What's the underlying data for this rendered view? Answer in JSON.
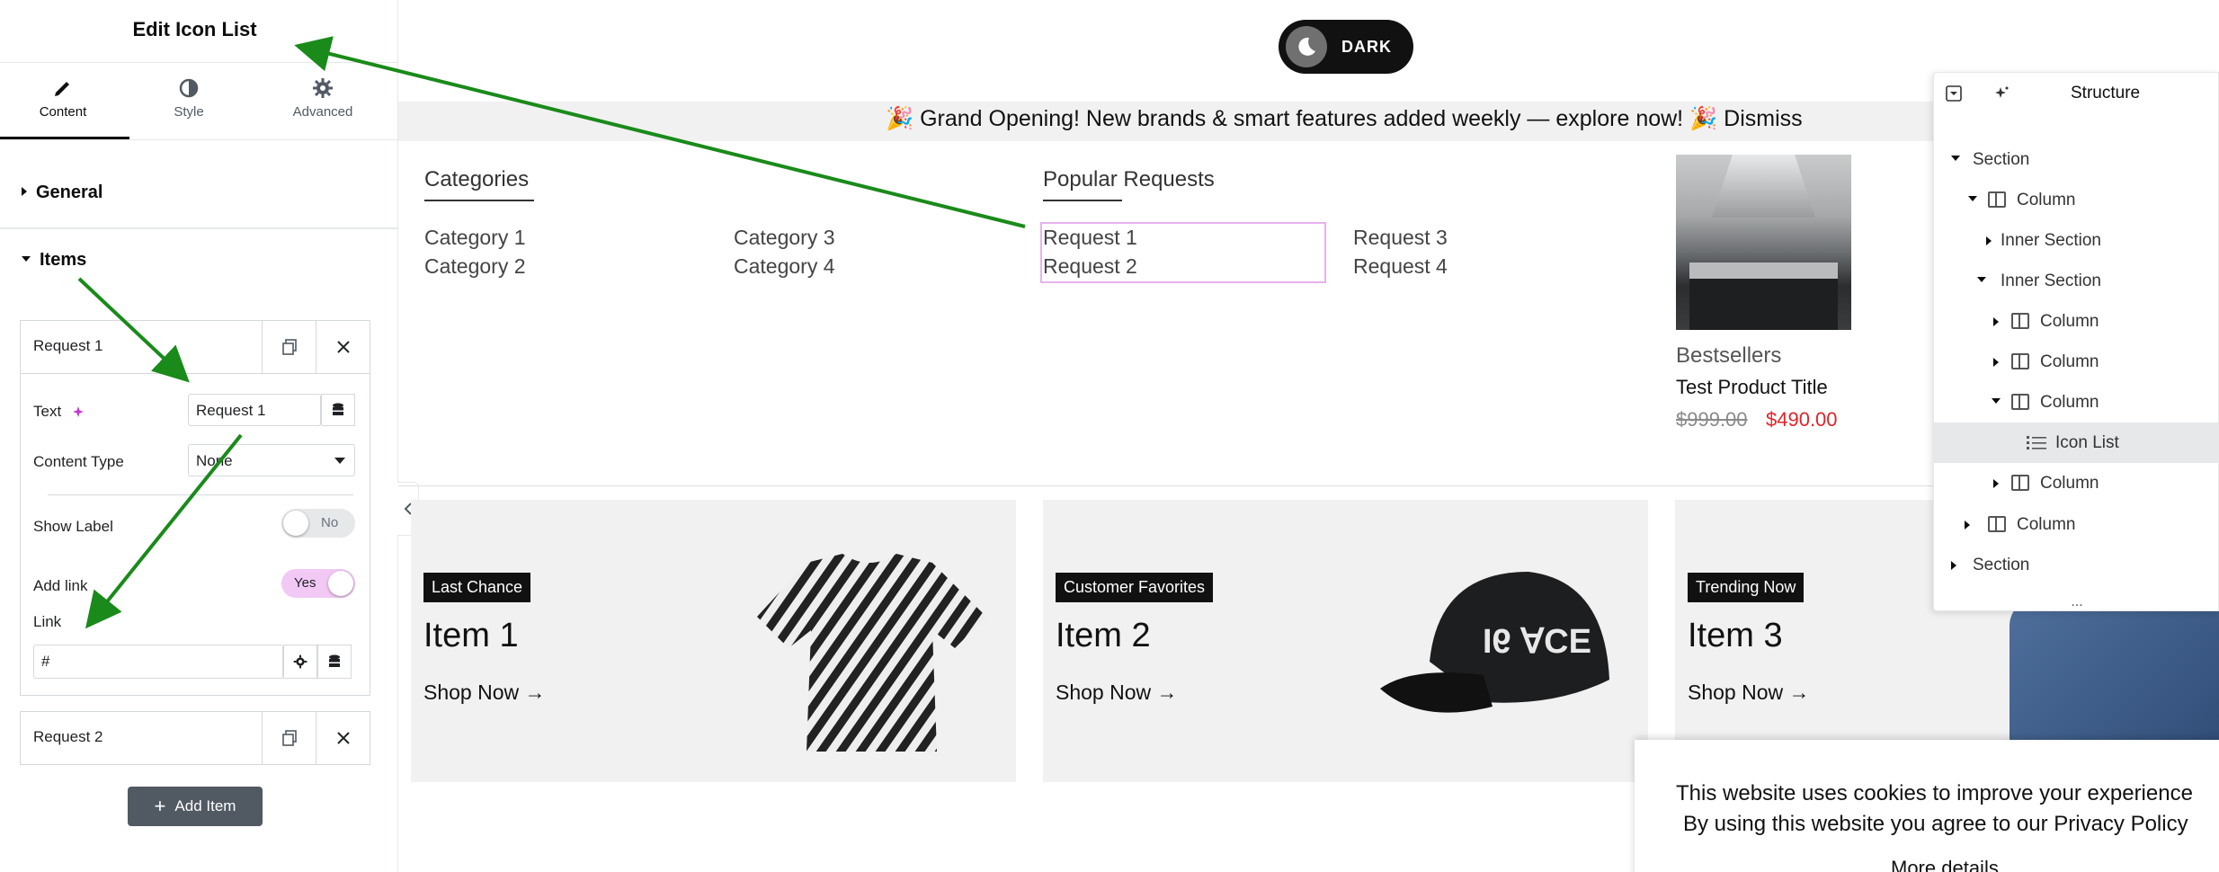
{
  "panel": {
    "title": "Edit Icon List",
    "tabs": [
      {
        "label": "Content",
        "icon": "pencil-icon"
      },
      {
        "label": "Style",
        "icon": "half-circle-icon"
      },
      {
        "label": "Advanced",
        "icon": "gear-icon"
      }
    ],
    "sections": {
      "general": "General",
      "items": "Items"
    },
    "items": [
      {
        "label": "Request 1",
        "fields": {
          "text_label": "Text",
          "text_value": "Request 1",
          "content_type_label": "Content Type",
          "content_type_value": "None",
          "show_label_label": "Show Label",
          "show_label_value": "No",
          "add_link_label": "Add link",
          "add_link_value": "Yes",
          "link_label": "Link",
          "link_value": "#"
        }
      },
      {
        "label": "Request 2"
      }
    ],
    "add_item_label": "Add Item"
  },
  "canvas": {
    "dark_toggle_label": "DARK",
    "banner": "🎉 Grand Opening! New brands & smart features added weekly — explore now! 🎉 Dismiss",
    "categories": {
      "title": "Categories",
      "links": [
        "Category 1",
        "Category 2",
        "Category 3",
        "Category 4"
      ]
    },
    "popular": {
      "title": "Popular Requests",
      "links": [
        "Request 1",
        "Request 2",
        "Request 3",
        "Request 4"
      ]
    },
    "product": {
      "section": "Bestsellers",
      "title": "Test Product Title",
      "old_price": "$999.00",
      "new_price": "$490.00"
    },
    "cards": [
      {
        "badge": "Last Chance",
        "title": "Item 1",
        "cta": "Shop Now →"
      },
      {
        "badge": "Customer Favorites",
        "title": "Item 2",
        "cta": "Shop Now →"
      },
      {
        "badge": "Trending Now",
        "title": "Item 3",
        "cta": "Shop Now →"
      }
    ]
  },
  "structure": {
    "title": "Structure",
    "rows": [
      {
        "label": "Section",
        "expanded": true
      },
      {
        "label": "Column",
        "expanded": true
      },
      {
        "label": "Inner Section",
        "expanded": false
      },
      {
        "label": "Inner Section",
        "expanded": true
      },
      {
        "label": "Column",
        "expanded": false
      },
      {
        "label": "Column",
        "expanded": false
      },
      {
        "label": "Column",
        "expanded": true
      },
      {
        "label": "Icon List",
        "selected": true
      },
      {
        "label": "Column",
        "expanded": false
      },
      {
        "label": "Column",
        "expanded": false
      },
      {
        "label": "Section",
        "expanded": false
      }
    ],
    "footer": "..."
  },
  "cookie": {
    "line1": "This website uses cookies to improve your experience",
    "line2": "By using this website you agree to our Privacy Policy",
    "line3": "More details"
  },
  "colors": {
    "accent_pink": "#e7b1ec",
    "price_red": "#e0242a",
    "annotation_arrow": "#1a8a1a",
    "toggle_on": "#f2c8f5"
  }
}
